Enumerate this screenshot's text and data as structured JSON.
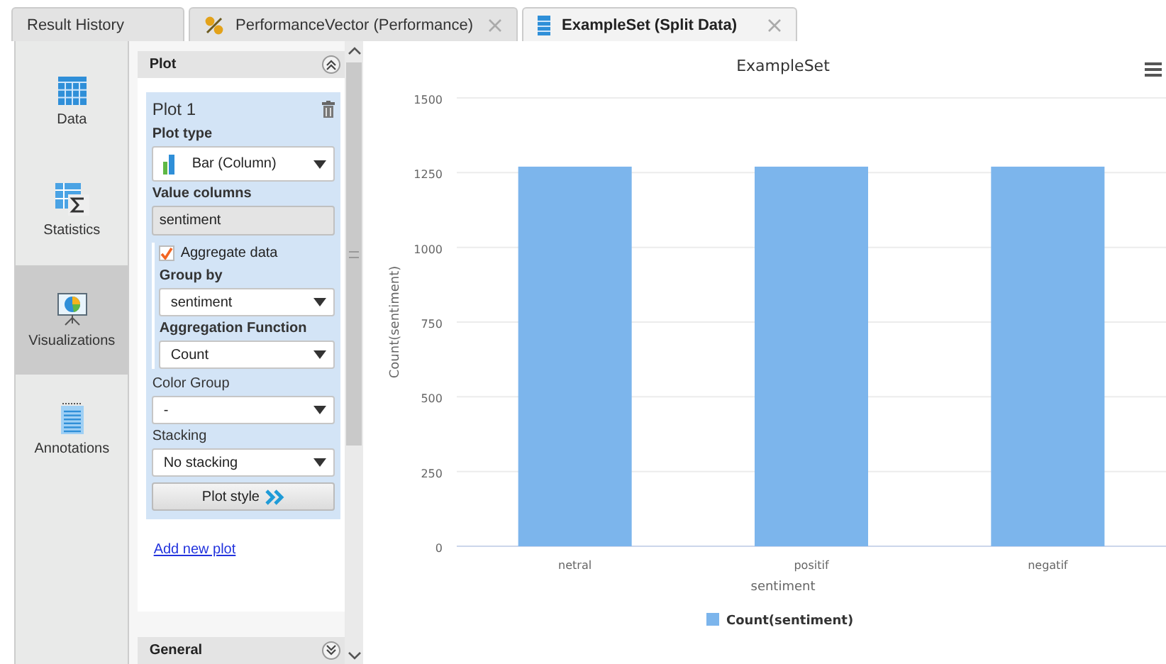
{
  "tabs": [
    {
      "label": "Result History",
      "kind": "plain",
      "selected": false,
      "closable": false
    },
    {
      "label": "PerformanceVector (Performance)",
      "kind": "performance",
      "selected": false,
      "closable": true
    },
    {
      "label": "ExampleSet (Split Data)",
      "kind": "table",
      "selected": true,
      "closable": true
    }
  ],
  "sidebar": {
    "items": [
      {
        "label": "Data",
        "kind": "table",
        "selected": false
      },
      {
        "label": "Statistics",
        "kind": "statistics",
        "selected": false
      },
      {
        "label": "Visualizations",
        "kind": "visualizations",
        "selected": true
      },
      {
        "label": "Annotations",
        "kind": "annotations",
        "selected": false
      }
    ]
  },
  "sections": [
    {
      "title": "Plot",
      "expanded": true
    },
    {
      "title": "General",
      "expanded": false
    }
  ],
  "plots": [
    {
      "title": "Plot 1",
      "plot_type": {
        "label": "Plot type",
        "value": "Bar (Column)"
      },
      "value_columns": {
        "label": "Value columns",
        "value": "sentiment"
      },
      "aggregate": {
        "label": "Aggregate data",
        "checked": true,
        "group_by": {
          "label": "Group by",
          "value": "sentiment"
        },
        "function": {
          "label": "Aggregation Function",
          "value": "Count"
        }
      },
      "color_group": {
        "label": "Color Group",
        "value": "-"
      },
      "stacking": {
        "label": "Stacking",
        "value": "No stacking"
      },
      "style_button": "Plot style"
    }
  ],
  "add_link": "Add new plot",
  "chart": {
    "chart_data": {
      "type": "bar",
      "grid": true,
      "title": "ExampleSet",
      "xlabel": "sentiment",
      "ylabel": "Count(sentiment)",
      "categories": [
        "netral",
        "positif",
        "negatif"
      ],
      "series": [
        {
          "name": "Count(sentiment)",
          "color": "#7cb5ec",
          "values": [
            1270,
            1270,
            1270
          ]
        }
      ],
      "ylim": [
        0,
        1500
      ],
      "yticks": [
        0,
        250,
        500,
        750,
        1000,
        1250,
        1500
      ]
    }
  }
}
